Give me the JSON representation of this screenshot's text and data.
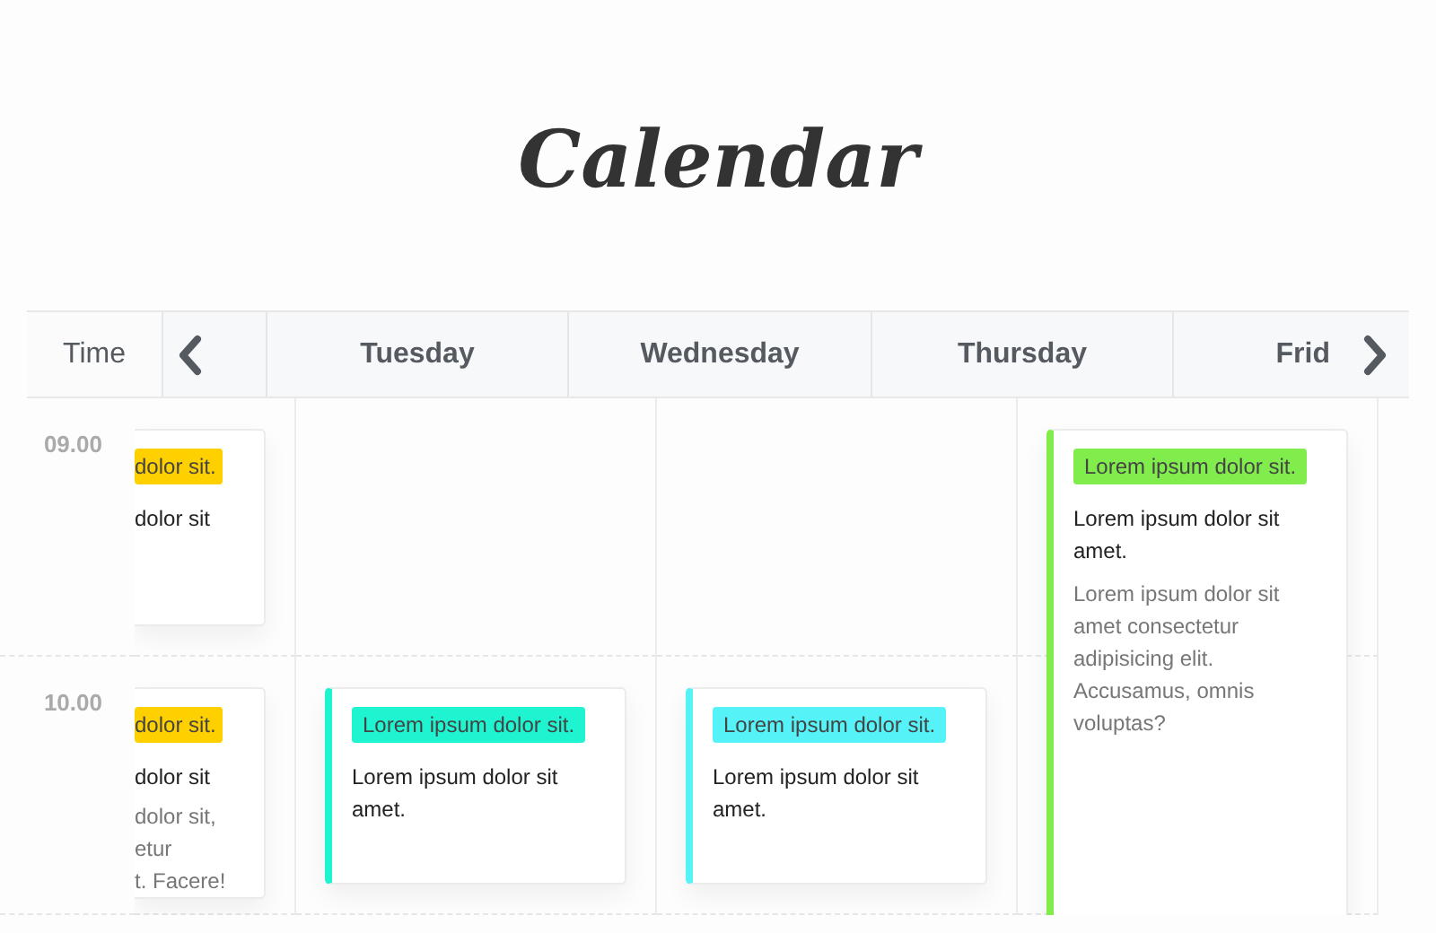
{
  "title": "Calendar",
  "header": {
    "time_label": "Time",
    "days": [
      "Tuesday",
      "Wednesday",
      "Thursday",
      "Frid"
    ]
  },
  "time_slots": [
    "09.00",
    "10.00"
  ],
  "columns": [
    {
      "clipped": true,
      "events": [
        {
          "kind": "early",
          "color": "#ffd000",
          "tag": "dolor sit.",
          "title": "dolor sit"
        },
        {
          "kind": "late",
          "color": "#ffd000",
          "tag": "dolor sit.",
          "title": "dolor sit",
          "description_lines": [
            "dolor sit,",
            "etur",
            "t. Facere!"
          ]
        }
      ]
    },
    {
      "clipped": false,
      "events": [
        {
          "kind": "late",
          "color": "#1ef5d0",
          "tag": "Lorem ipsum dolor sit.",
          "title": "Lorem ipsum dolor sit amet."
        }
      ]
    },
    {
      "clipped": false,
      "events": [
        {
          "kind": "late",
          "color": "#55f2f8",
          "tag": "Lorem ipsum dolor sit.",
          "title": "Lorem ipsum dolor sit amet."
        }
      ]
    },
    {
      "clipped": false,
      "events": [
        {
          "kind": "long",
          "color": "#80ed4c",
          "tag": "Lorem ipsum dolor sit.",
          "title": "Lorem ipsum dolor sit amet.",
          "description": "Lorem ipsum dolor sit amet consectetur adipisicing elit. Accusamus, omnis voluptas?"
        }
      ]
    }
  ]
}
